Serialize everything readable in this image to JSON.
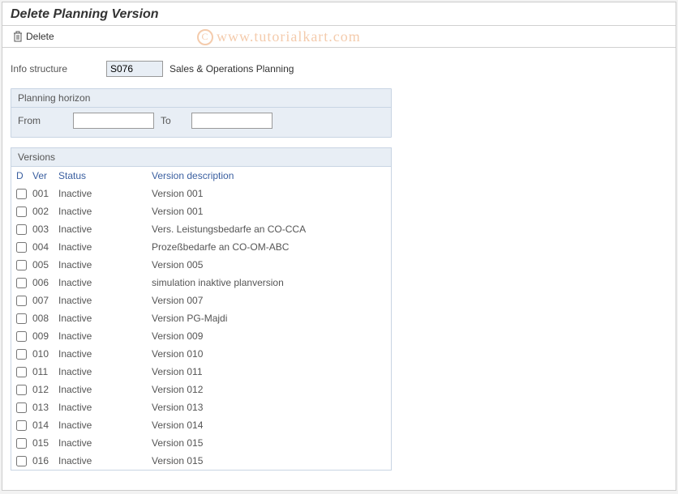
{
  "page_title": "Delete Planning Version",
  "toolbar": {
    "delete_label": "Delete"
  },
  "info_structure": {
    "label": "Info structure",
    "value": "S076",
    "desc": "Sales & Operations Planning"
  },
  "planning_horizon": {
    "title": "Planning horizon",
    "from_label": "From",
    "to_label": "To",
    "from_value": "",
    "to_value": ""
  },
  "versions": {
    "title": "Versions",
    "headers": {
      "d": "D",
      "ver": "Ver",
      "status": "Status",
      "desc": "Version description"
    },
    "rows": [
      {
        "ver": "001",
        "status": "Inactive",
        "desc": "Version 001"
      },
      {
        "ver": "002",
        "status": "Inactive",
        "desc": "Version 001"
      },
      {
        "ver": "003",
        "status": "Inactive",
        "desc": "Vers. Leistungsbedarfe an CO-CCA"
      },
      {
        "ver": "004",
        "status": "Inactive",
        "desc": "Prozeßbedarfe an CO-OM-ABC"
      },
      {
        "ver": "005",
        "status": "Inactive",
        "desc": "Version 005"
      },
      {
        "ver": "006",
        "status": "Inactive",
        "desc": "simulation inaktive planversion"
      },
      {
        "ver": "007",
        "status": "Inactive",
        "desc": "Version 007"
      },
      {
        "ver": "008",
        "status": "Inactive",
        "desc": "Version PG-Majdi"
      },
      {
        "ver": "009",
        "status": "Inactive",
        "desc": "Version 009"
      },
      {
        "ver": "010",
        "status": "Inactive",
        "desc": "Version 010"
      },
      {
        "ver": "011",
        "status": "Inactive",
        "desc": "Version 011"
      },
      {
        "ver": "012",
        "status": "Inactive",
        "desc": "Version 012"
      },
      {
        "ver": "013",
        "status": "Inactive",
        "desc": "Version 013"
      },
      {
        "ver": "014",
        "status": "Inactive",
        "desc": "Version 014"
      },
      {
        "ver": "015",
        "status": "Inactive",
        "desc": "Version 015"
      },
      {
        "ver": "016",
        "status": "Inactive",
        "desc": "Version 015"
      }
    ]
  },
  "watermark": "www.tutorialkart.com"
}
